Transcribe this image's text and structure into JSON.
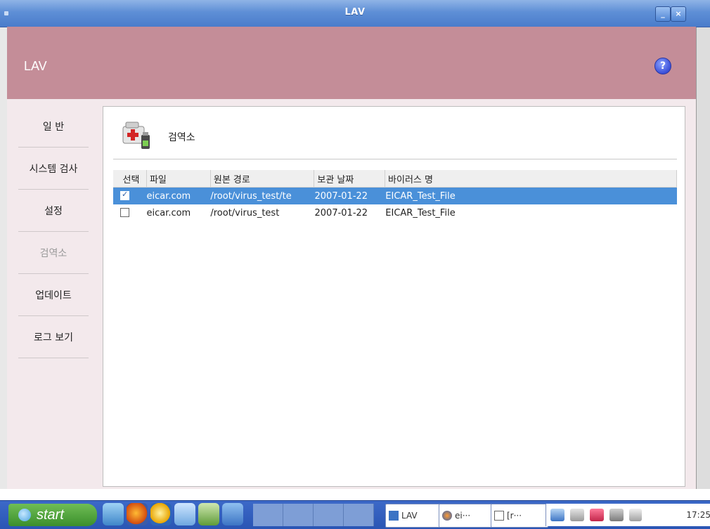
{
  "window": {
    "title": "LAV",
    "min_label": "_",
    "close_label": "×"
  },
  "header": {
    "app_title": "LAV",
    "help_label": "?"
  },
  "sidebar": {
    "items": [
      {
        "label": "일 반"
      },
      {
        "label": "시스템 검사"
      },
      {
        "label": "설정"
      },
      {
        "label": "검역소",
        "active": true
      },
      {
        "label": "업데이트"
      },
      {
        "label": "로그 보기"
      }
    ]
  },
  "page": {
    "title": "검역소",
    "icon": "quarantine-icon"
  },
  "table": {
    "columns": [
      "선택",
      "파일",
      "원본 경로",
      "보관 날짜",
      "바이러스 명"
    ],
    "rows": [
      {
        "checked": true,
        "selected": true,
        "file": "eicar.com",
        "path": "/root/virus_test/te",
        "date": "2007-01-22",
        "virus": "EICAR_Test_File"
      },
      {
        "checked": false,
        "selected": false,
        "file": "eicar.com",
        "path": "/root/virus_test",
        "date": "2007-01-22",
        "virus": "EICAR_Test_File"
      }
    ]
  },
  "taskbar": {
    "start_label": "start",
    "tasks": [
      {
        "label": "LAV"
      },
      {
        "label": "ei···"
      },
      {
        "label": "[r···"
      }
    ],
    "clock": "17:25"
  },
  "colors": {
    "header": "#c48d98",
    "selection": "#4a90d9",
    "titlebar": "#5e8fd6"
  }
}
